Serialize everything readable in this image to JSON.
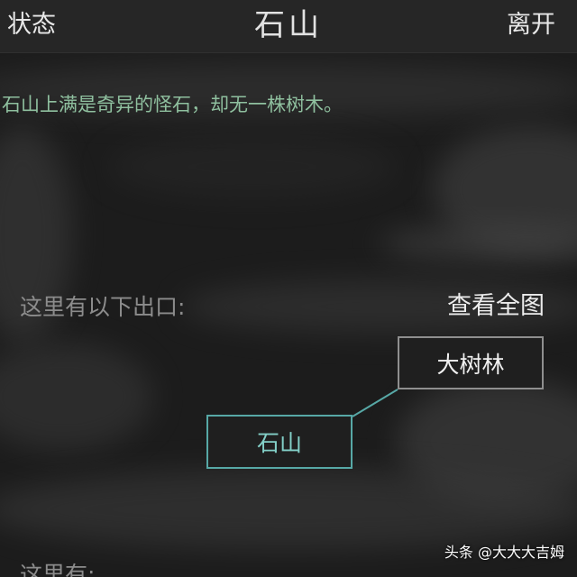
{
  "header": {
    "left_label": "状态",
    "title": "石山",
    "right_label": "离开"
  },
  "room": {
    "description": "石山上满是奇异的怪石，却无一株树木。"
  },
  "exits": {
    "label": "这里有以下出口:",
    "map_link": "查看全图",
    "nodes": [
      {
        "name": "大树林",
        "role": "exit"
      },
      {
        "name": "石山",
        "role": "current"
      }
    ]
  },
  "footer": {
    "partial_label": "这里有:"
  },
  "watermark": {
    "text": "头条 @大大大吉姆"
  },
  "colors": {
    "description_text": "#8fc09f",
    "current_node_border": "#57a8a6",
    "exit_node_border": "#8f8f8f",
    "connector_line": "#57a8a6"
  }
}
